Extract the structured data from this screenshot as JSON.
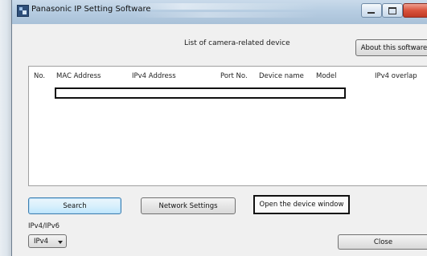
{
  "window": {
    "title": "Panasonic IP Setting Software"
  },
  "header": {
    "list_title": "List of camera-related device",
    "about_label": "About this software"
  },
  "table": {
    "columns": [
      "No.",
      "MAC Address",
      "IPv4 Address",
      "Port No.",
      "Device name",
      "Model",
      "IPv4 overlap"
    ],
    "rows": []
  },
  "buttons": {
    "search": "Search",
    "network_settings": "Network Settings",
    "open_device": "Open the device window",
    "close": "Close"
  },
  "ip_version": {
    "label": "IPv4/IPv6",
    "selected": "IPv4"
  }
}
